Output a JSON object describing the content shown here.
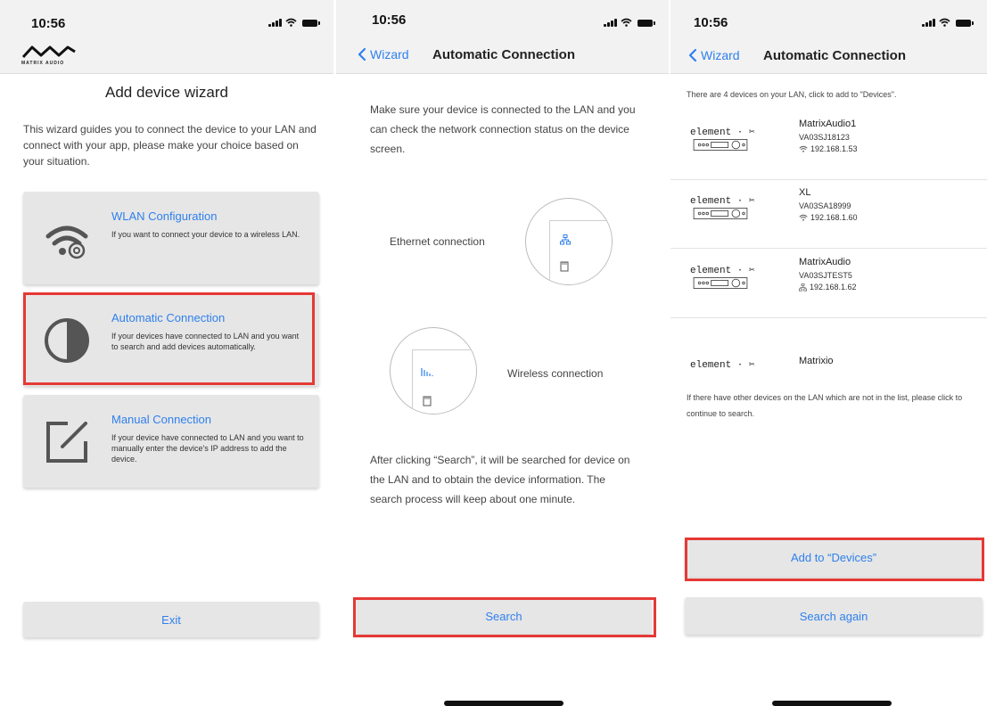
{
  "status": {
    "time": "10:56"
  },
  "screen1": {
    "brand": "MATRIX AUDIO",
    "title": "Add device wizard",
    "intro": "This wizard guides you to connect the device to your LAN and connect with your app, please make your choice based on your situation.",
    "options": [
      {
        "title": "WLAN Configuration",
        "desc": "If you want to connect your device to a wireless LAN."
      },
      {
        "title": "Automatic Connection",
        "desc": "If your devices have connected to LAN and you want to search and add devices automatically."
      },
      {
        "title": "Manual Connection",
        "desc": "If your device have connected to LAN and you want to manually enter the device's IP address to add the device."
      }
    ],
    "exit_label": "Exit"
  },
  "screen2": {
    "back_label": "Wizard",
    "title": "Automatic Connection",
    "instructions": "Make sure your device is connected to the LAN and you can check the network connection status on the device screen.",
    "ethernet_label": "Ethernet connection",
    "wireless_label": "Wireless connection",
    "search_info": "After clicking “Search”, it will be searched for device on the LAN and to obtain the device information. The search process will keep about one minute.",
    "search_label": "Search"
  },
  "screen3": {
    "back_label": "Wizard",
    "title": "Automatic Connection",
    "found_text": "There are 4 devices on your LAN, click to add to \"Devices\".",
    "devices": [
      {
        "brand": "element · ✂",
        "name": "MatrixAudio1",
        "serial": "VA03SJ18123",
        "ip": "192.168.1.53",
        "conn": "wifi"
      },
      {
        "brand": "element · ✂",
        "name": "XL",
        "serial": "VA03SA18999",
        "ip": "192.168.1.60",
        "conn": "wifi"
      },
      {
        "brand": "element · ✂",
        "name": "MatrixAudio",
        "serial": "VA03SJTEST5",
        "ip": "192.168.1.62",
        "conn": "ethernet"
      },
      {
        "brand": "element · ✂",
        "name": "Matrixio",
        "serial": "",
        "ip": "",
        "conn": ""
      }
    ],
    "more_text": "If there have other devices on the LAN which are not in the list, please click to continue to search.",
    "add_label": "Add to “Devices”",
    "search_again_label": "Search again"
  },
  "colors": {
    "accent": "#2f80ed",
    "highlight": "#e53935",
    "card": "#e6e6e6",
    "bar": "#f2f2f2"
  }
}
